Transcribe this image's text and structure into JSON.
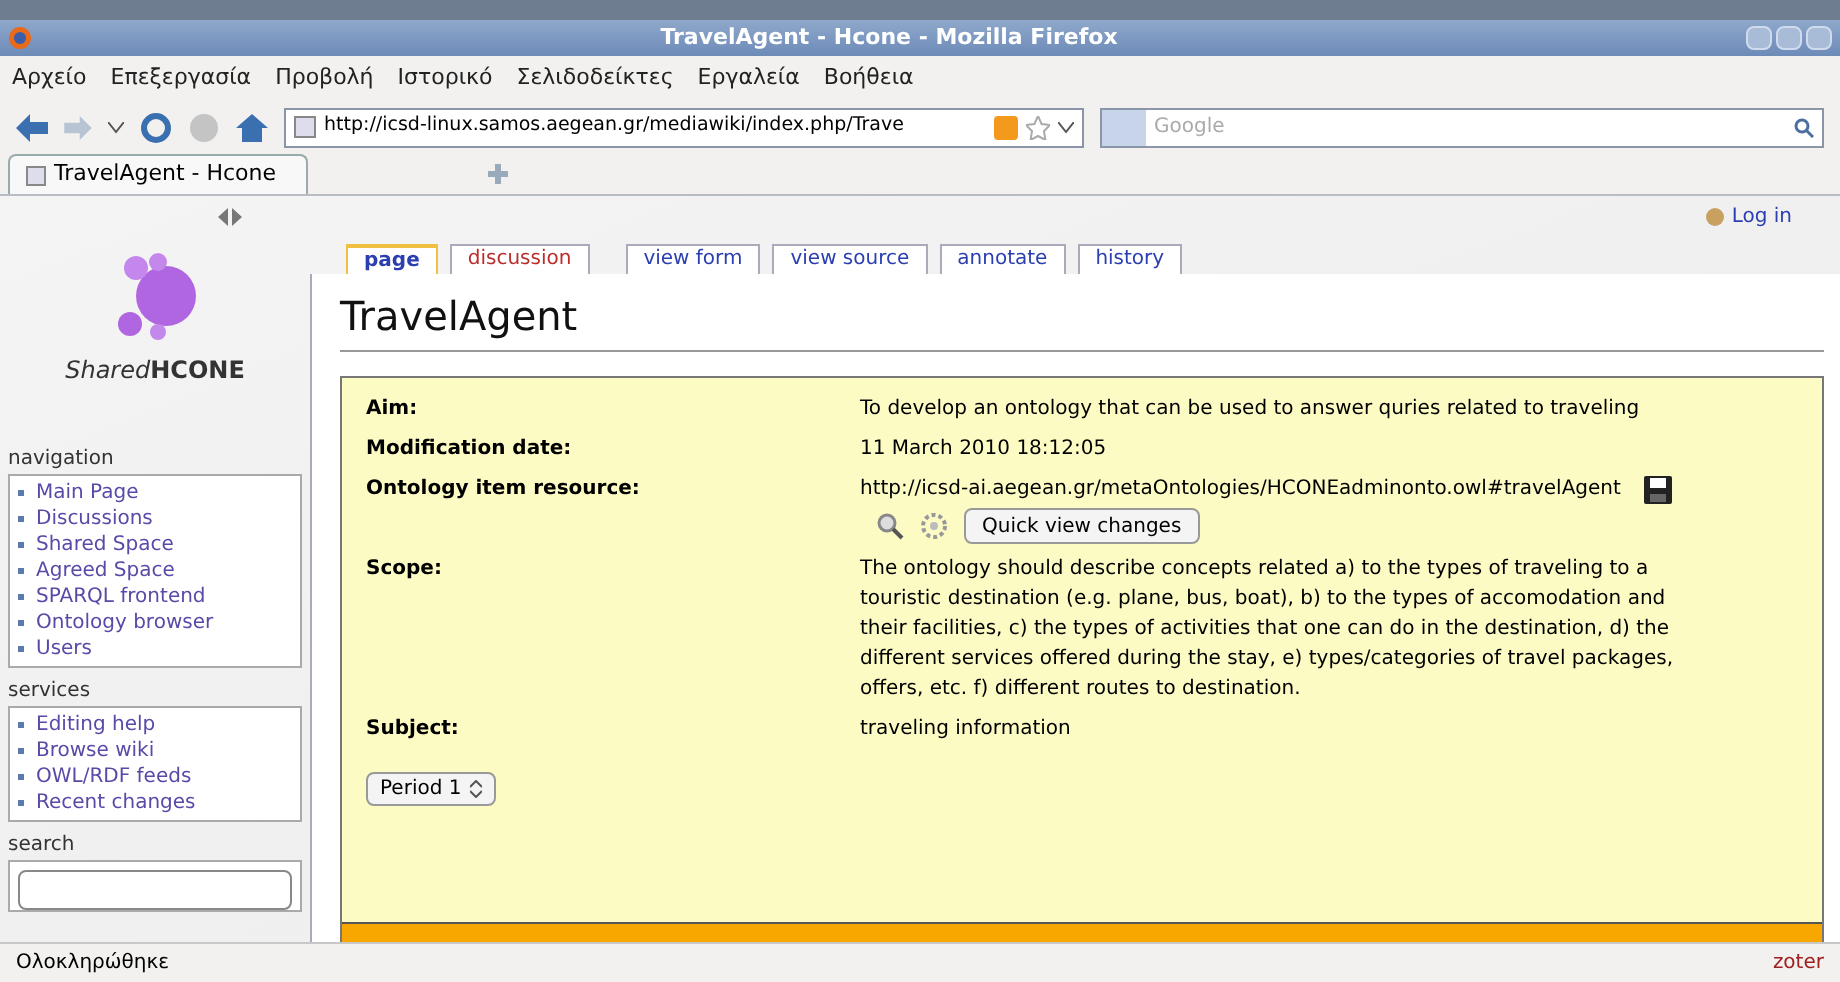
{
  "window": {
    "title": "TravelAgent - Hcone - Mozilla Firefox"
  },
  "menu": [
    "Αρχείο",
    "Επεξεργασία",
    "Προβολή",
    "Ιστορικό",
    "Σελιδοδείκτες",
    "Εργαλεία",
    "Βοήθεια"
  ],
  "address": {
    "value": "http://icsd-linux.samos.aegean.gr/mediawiki/index.php/Trave"
  },
  "search": {
    "placeholder": "Google"
  },
  "browser_tabs": [
    {
      "label": "TravelAgent - Hcone",
      "selected": true
    }
  ],
  "personal": {
    "login": "Log in"
  },
  "logo": {
    "light": "Shared",
    "bold": "HCONE"
  },
  "sidebar": [
    {
      "heading": "navigation",
      "items": [
        "Main Page",
        "Discussions",
        "Shared Space",
        "Agreed Space",
        "SPARQL frontend",
        "Ontology browser",
        "Users"
      ]
    },
    {
      "heading": "services",
      "items": [
        "Editing help",
        "Browse wiki",
        "OWL/RDF feeds",
        "Recent changes"
      ]
    },
    {
      "heading": "search"
    }
  ],
  "page_tabs": [
    {
      "label": "page",
      "selected": true,
      "color": "#2b3fb0"
    },
    {
      "label": "discussion",
      "selected": false,
      "color": "#ba2d2d"
    },
    {
      "label": "view form",
      "selected": false,
      "color": "#2b3fb0"
    },
    {
      "label": "view source",
      "selected": false,
      "color": "#2b3fb0"
    },
    {
      "label": "annotate",
      "selected": false,
      "color": "#2b3fb0"
    },
    {
      "label": "history",
      "selected": false,
      "color": "#2b3fb0"
    }
  ],
  "heading": "TravelAgent",
  "properties": [
    {
      "label": "Aim:",
      "value": "To develop an ontology that can be used to answer quries related to traveling",
      "kind": "text"
    },
    {
      "label": "Modification date:",
      "value": "11 March 2010 18:12:05",
      "kind": "text"
    },
    {
      "label": "Ontology item resource:",
      "value": "http://icsd-ai.aegean.gr/metaOntologies/HCONEadminonto.owl#travelAgent",
      "kind": "resource",
      "button": "Quick view changes"
    },
    {
      "label": "Scope:",
      "value": "The ontology should describe concepts related a) to the types of traveling to a touristic destination (e.g. plane, bus, boat), b) to the types of accomodation and their facilities, c) the types of activities that one can do in the destination, d) the different services offered during the stay, e) types/categories of travel packages, offers, etc. f) different routes to destination.",
      "kind": "text"
    },
    {
      "label": "Subject:",
      "value": "traveling information",
      "kind": "text"
    }
  ],
  "period": {
    "value": "Period 1"
  },
  "status_bar": {
    "text": "Ολοκληρώθηκε",
    "right": "zoter"
  }
}
